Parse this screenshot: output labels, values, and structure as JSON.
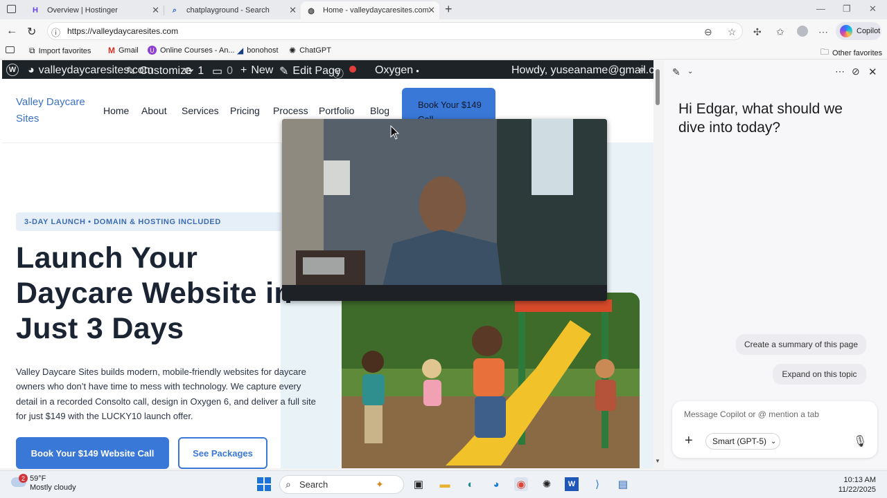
{
  "browser": {
    "tabs": [
      {
        "title": "Overview | Hostinger",
        "icon": "hostinger-icon"
      },
      {
        "title": "chatplayground - Search",
        "icon": "search-icon"
      },
      {
        "title": "Home - valleydaycaresites.com",
        "icon": "globe-icon"
      }
    ],
    "url": "https://valleydaycaresites.com",
    "copilot_label": "Copilot",
    "bookmarks": [
      "Import favorites",
      "Gmail",
      "Online Courses - An...",
      "bonohost",
      "ChatGPT"
    ],
    "other_favorites": "Other favorites"
  },
  "wp_admin": {
    "site": "valleydaycaresites.com",
    "customize": "Customize",
    "updates": "1",
    "comments": "0",
    "new": "New",
    "edit": "Edit Page",
    "oxygen": "Oxygen",
    "howdy": "Howdy, yuseaname@gmail.com"
  },
  "site": {
    "logo": "Valley Daycare Sites",
    "nav": [
      "Home",
      "About",
      "Services",
      "Pricing",
      "Process",
      "Portfolio",
      "Blog"
    ],
    "cta": "Book Your $149 Call",
    "badge": "3-DAY LAUNCH • DOMAIN & HOSTING INCLUDED",
    "headline": "Launch Your Daycare Website in Just 3 Days",
    "paragraph": "Valley Daycare Sites builds modern, mobile-friendly websites for daycare owners who don’t have time to mess with technology. We capture every detail in a recorded Consolto call, design in Oxygen 6, and deliver a full site for just $149 with the LUCKY10 launch offer.",
    "btn_primary": "Book Your $149 Website Call",
    "btn_secondary": "See Packages"
  },
  "copilot": {
    "greeting": "Hi Edgar, what should we dive into today?",
    "suggestions": [
      "Create a summary of this page",
      "Expand on this topic"
    ],
    "placeholder": "Message Copilot or @ mention a tab",
    "model": "Smart (GPT-5)"
  },
  "taskbar": {
    "search": "Search",
    "temp": "59°F",
    "weather": "Mostly cloudy",
    "weather_badge": "2",
    "time": "10:13 AM",
    "date": "11/22/2025"
  }
}
